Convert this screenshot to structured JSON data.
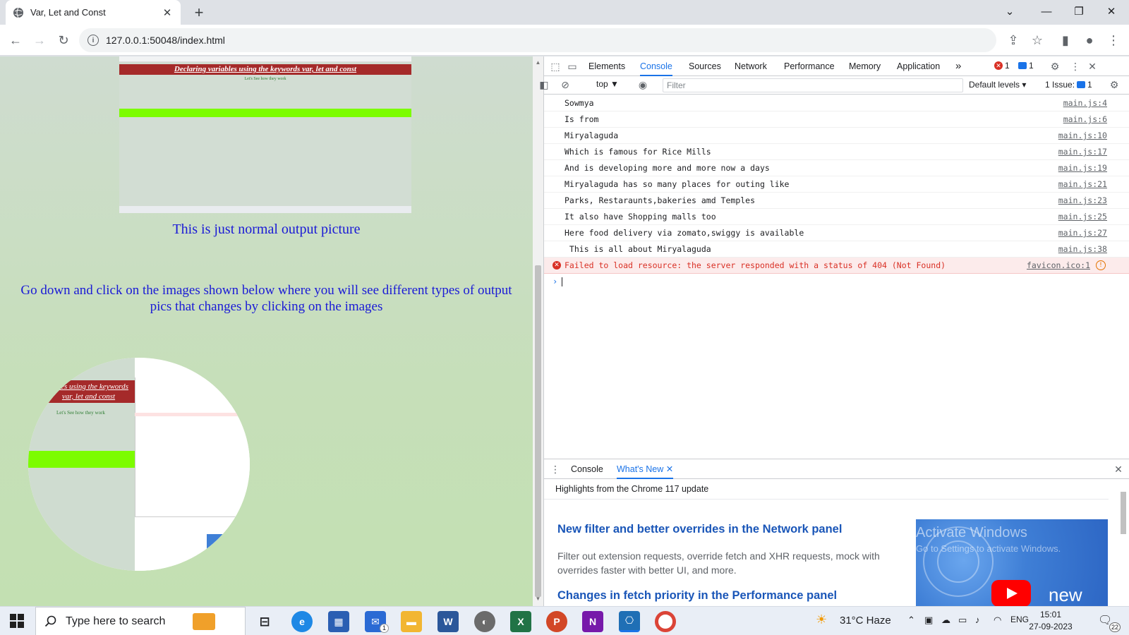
{
  "browser": {
    "tab_title": "Var, Let and Const",
    "url": "127.0.0.1:50048/index.html"
  },
  "page": {
    "thumbnail_banner": "Declaring variables using the keywords var, let and const",
    "thumbnail_sub": "Let's See how they work",
    "normal_caption": "This is just normal output picture",
    "instructions": "Go down and click on the images shown below where you will see different types of output pics that changes by clicking on the images",
    "circle_banner": "iables using the keywords var, let and const",
    "circle_sub": "Let's See how they work"
  },
  "devtools": {
    "tabs": [
      "Elements",
      "Console",
      "Sources",
      "Network",
      "Performance",
      "Memory",
      "Application"
    ],
    "active_tab": "Console",
    "more_tabs": "»",
    "error_count": "1",
    "message_count": "1",
    "context": "top",
    "filter_placeholder": "Filter",
    "levels": "Default levels",
    "issues_label": "1 Issue:",
    "issues_count": "1",
    "logs": [
      {
        "msg": "Sowmya",
        "src": "main.js:4"
      },
      {
        "msg": "Is from",
        "src": "main.js:6"
      },
      {
        "msg": "Miryalaguda",
        "src": "main.js:10"
      },
      {
        "msg": "Which is famous for Rice Mills",
        "src": "main.js:17"
      },
      {
        "msg": "And is developing more and more now a days",
        "src": "main.js:19"
      },
      {
        "msg": "Miryalaguda has so many places for outing like",
        "src": "main.js:21"
      },
      {
        "msg": "Parks, Restaraunts,bakeries amd Temples",
        "src": "main.js:23"
      },
      {
        "msg": "It also have Shopping malls too",
        "src": "main.js:25"
      },
      {
        "msg": "Here food delivery via zomato,swiggy is available",
        "src": "main.js:27"
      },
      {
        "msg": " This is all about Miryalaguda",
        "src": "main.js:38"
      }
    ],
    "error": {
      "msg": "Failed to load resource: the server responded with a status of 404 (Not Found)",
      "src": "favicon.ico:1"
    },
    "drawer": {
      "tab_console": "Console",
      "tab_whats_new": "What's New",
      "header": "Highlights from the Chrome 117 update",
      "h1": "New filter and better overrides in the Network panel",
      "p": "Filter out extension requests, override fetch and XHR requests, mock with overrides faster with better UI, and more.",
      "h2": "Changes in fetch priority in the Performance panel",
      "video_label": "new",
      "watermark1": "Activate Windows",
      "watermark2": "Go to Settings to activate Windows."
    }
  },
  "taskbar": {
    "search_placeholder": "Type here to search",
    "weather": "31°C  Haze",
    "lang": "ENG",
    "time": "15:01",
    "date": "27-09-2023",
    "notifications": "22",
    "mail_badge": "1"
  }
}
